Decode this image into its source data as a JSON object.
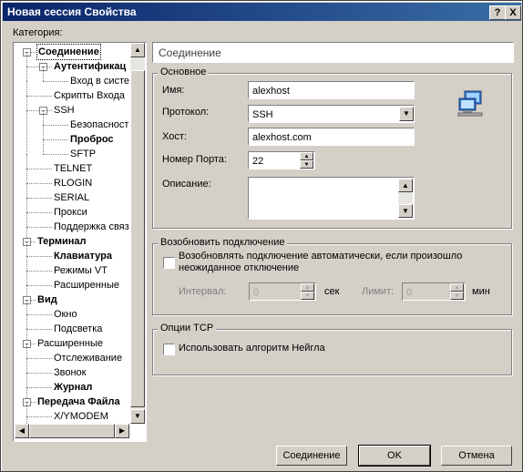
{
  "window": {
    "title": "Новая сессия Свойства",
    "help_btn": "?",
    "close_btn": "X"
  },
  "category_label": "Категория:",
  "tree": [
    {
      "label": "Соединение",
      "bold": true,
      "selected": true,
      "level": 0,
      "toggle": "-"
    },
    {
      "label": "Аутентификац",
      "bold": true,
      "level": 1,
      "toggle": "-"
    },
    {
      "label": "Вход в систе",
      "bold": false,
      "level": 2
    },
    {
      "label": "Скрипты Входа",
      "bold": false,
      "level": 1
    },
    {
      "label": "SSH",
      "bold": false,
      "level": 1,
      "toggle": "-"
    },
    {
      "label": "Безопасност",
      "bold": false,
      "level": 2
    },
    {
      "label": "Проброс",
      "bold": true,
      "level": 2
    },
    {
      "label": "SFTP",
      "bold": false,
      "level": 2
    },
    {
      "label": "TELNET",
      "bold": false,
      "level": 1
    },
    {
      "label": "RLOGIN",
      "bold": false,
      "level": 1
    },
    {
      "label": "SERIAL",
      "bold": false,
      "level": 1
    },
    {
      "label": "Прокси",
      "bold": false,
      "level": 1
    },
    {
      "label": "Поддержка связ",
      "bold": false,
      "level": 1
    },
    {
      "label": "Терминал",
      "bold": true,
      "level": 0,
      "toggle": "-"
    },
    {
      "label": "Клавиатура",
      "bold": true,
      "level": 1
    },
    {
      "label": "Режимы VT",
      "bold": false,
      "level": 1
    },
    {
      "label": "Расширенные",
      "bold": false,
      "level": 1
    },
    {
      "label": "Вид",
      "bold": true,
      "level": 0,
      "toggle": "-"
    },
    {
      "label": "Окно",
      "bold": false,
      "level": 1
    },
    {
      "label": "Подсветка",
      "bold": false,
      "level": 1
    },
    {
      "label": "Расширенные",
      "bold": false,
      "level": 0,
      "toggle": "-"
    },
    {
      "label": "Отслеживание",
      "bold": false,
      "level": 1
    },
    {
      "label": "Звонок",
      "bold": false,
      "level": 1
    },
    {
      "label": "Журнал",
      "bold": true,
      "level": 1
    },
    {
      "label": "Передача Файла",
      "bold": true,
      "level": 0,
      "toggle": "-"
    },
    {
      "label": "X/YMODEM",
      "bold": false,
      "level": 1
    }
  ],
  "panel": {
    "header": "Соединение",
    "basic": {
      "group_label": "Основное",
      "name_label": "Имя:",
      "name_value": "alexhost",
      "protocol_label": "Протокол:",
      "protocol_value": "SSH",
      "host_label": "Хост:",
      "host_value": "alexhost.com",
      "port_label": "Номер Порта:",
      "port_value": "22",
      "desc_label": "Описание:",
      "desc_value": ""
    },
    "reconnect": {
      "group_label": "Возобновить подключение",
      "checkbox_label_line1": "Возобновлять подключение автоматически, если произошло",
      "checkbox_label_line2": "неожиданное отключение",
      "checked": false,
      "interval_label": "Интервал:",
      "interval_value": "0",
      "interval_unit": "сек",
      "limit_label": "Лимит:",
      "limit_value": "0",
      "limit_unit": "мин"
    },
    "tcp": {
      "group_label": "Опции TCP",
      "nagle_label": "Использовать алгоритм Нейгла",
      "checked": false
    }
  },
  "buttons": {
    "connect": "Соединение",
    "ok": "OK",
    "cancel": "Отмена"
  },
  "colors": {
    "titlebar_start": "#0a246a",
    "titlebar_end": "#3a6ea5",
    "face": "#d4d0c8",
    "selection": "#000080"
  }
}
